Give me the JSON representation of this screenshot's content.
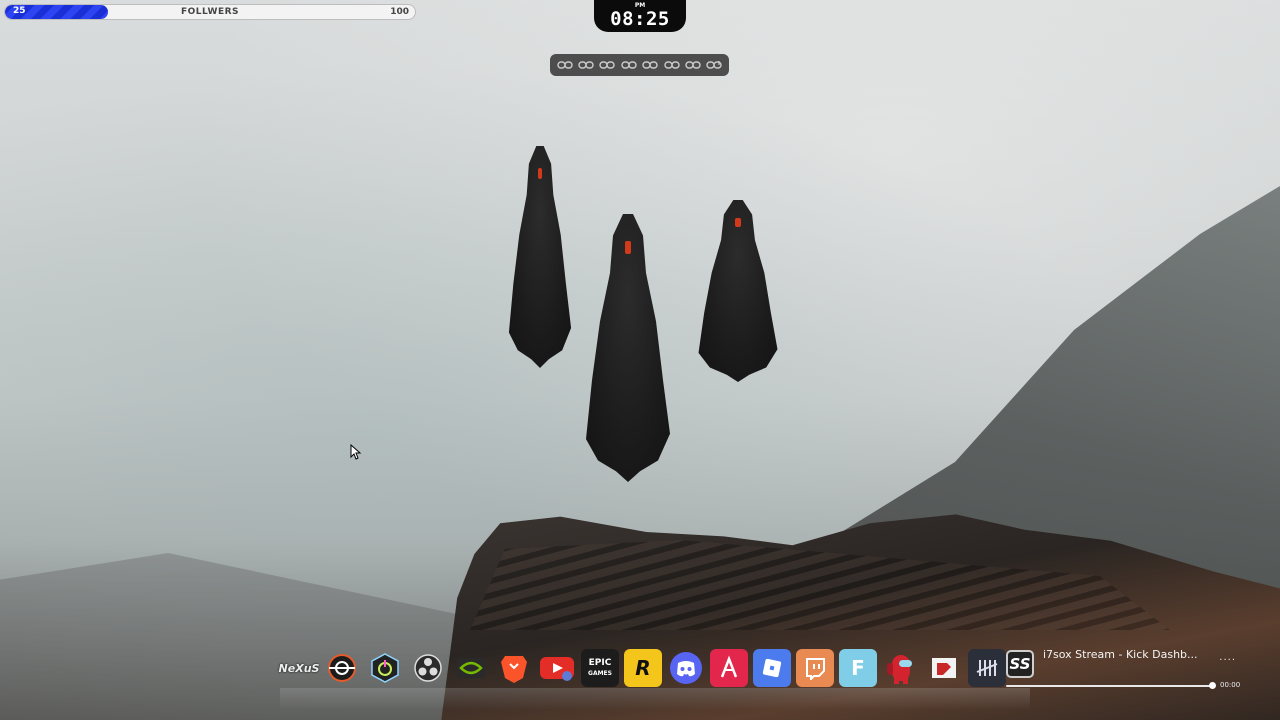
{
  "followers_bar": {
    "current": "25",
    "title": "FOLLWERS",
    "max": "100",
    "progress_fraction": 0.25,
    "fill_color": "#1b2fd6"
  },
  "clock": {
    "ampm": "PM",
    "time": "08:25"
  },
  "link_toolbar": {
    "icons": [
      "link-icon",
      "link-icon",
      "link-icon",
      "link-icon",
      "link-icon",
      "link-icon",
      "link-icon",
      "link-add-icon"
    ]
  },
  "dock": {
    "apps": [
      {
        "name": "nexus-app",
        "label": "NeXuS"
      },
      {
        "name": "crosshair-app"
      },
      {
        "name": "power-app"
      },
      {
        "name": "obs-app"
      },
      {
        "name": "nvidia-app"
      },
      {
        "name": "brave-app"
      },
      {
        "name": "youtube-app"
      },
      {
        "name": "epic-games-app",
        "label": "EPIC\nGAMES"
      },
      {
        "name": "rockstar-app",
        "label": "R"
      },
      {
        "name": "discord-app"
      },
      {
        "name": "arrow-app"
      },
      {
        "name": "roblox-app"
      },
      {
        "name": "twitch-app"
      },
      {
        "name": "f-app",
        "label": "F"
      },
      {
        "name": "among-us-app"
      },
      {
        "name": "dispatch-app"
      },
      {
        "name": "dead-by-daylight-app"
      }
    ]
  },
  "media_player": {
    "logo_text": "SS",
    "track_title": "i7sox Stream - Kick Dashb...",
    "elapsed": "00:00",
    "menu": "....",
    "progress_fraction": 0.98
  }
}
